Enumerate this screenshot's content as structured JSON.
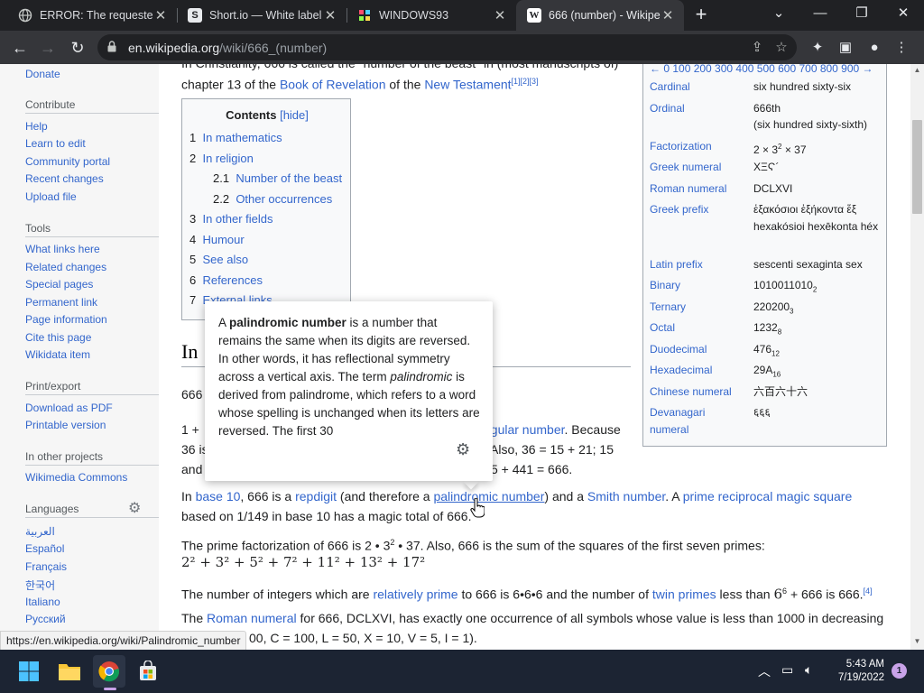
{
  "browser": {
    "tabs": [
      {
        "title": "ERROR: The requested",
        "icon": "globe-icon"
      },
      {
        "title": "Short.io — White label",
        "icon": "shortio-icon"
      },
      {
        "title": "WINDOWS93",
        "icon": "windows93-icon"
      },
      {
        "title": "666 (number) - Wikipe",
        "icon": "wikipedia-icon"
      }
    ],
    "url_domain": "en.wikipedia.org",
    "url_path": "/wiki/666_(number)",
    "status_url": "https://en.wikipedia.org/wiki/Palindromic_number"
  },
  "sidebar": {
    "donate": "Donate",
    "contribute": {
      "heading": "Contribute",
      "items": [
        "Help",
        "Learn to edit",
        "Community portal",
        "Recent changes",
        "Upload file"
      ]
    },
    "tools": {
      "heading": "Tools",
      "items": [
        "What links here",
        "Related changes",
        "Special pages",
        "Permanent link",
        "Page information",
        "Cite this page",
        "Wikidata item"
      ]
    },
    "print": {
      "heading": "Print/export",
      "items": [
        "Download as PDF",
        "Printable version"
      ]
    },
    "projects": {
      "heading": "In other projects",
      "items": [
        "Wikimedia Commons"
      ]
    },
    "languages": {
      "heading": "Languages",
      "items": [
        "العربية",
        "Español",
        "Français",
        "한국어",
        "Italiano",
        "Русский"
      ]
    }
  },
  "article": {
    "top_line_partial": "In Christianity, 666 is called the \"number of the beast\" in (most manuscripts of)",
    "line2_a": "chapter 13 of the ",
    "line2_link1": "Book of Revelation",
    "line2_b": " of the ",
    "line2_link2": "New Testament",
    "line2_sup": "[1][2][3]",
    "toc": {
      "title": "Contents",
      "hide": "[hide]",
      "items": [
        {
          "num": "1",
          "label": "In mathematics"
        },
        {
          "num": "2",
          "label": "In religion"
        },
        {
          "num": "2.1",
          "label": "Number of the beast"
        },
        {
          "num": "2.2",
          "label": "Other occurrences"
        },
        {
          "num": "3",
          "label": "In other fields"
        },
        {
          "num": "4",
          "label": "Humour"
        },
        {
          "num": "5",
          "label": "See also"
        },
        {
          "num": "6",
          "label": "References"
        },
        {
          "num": "7",
          "label": "External links"
        }
      ]
    },
    "heading_partial": "In",
    "p1_partial": "666",
    "p2_l1_start": "1 +",
    "p2_l1_link": "ngular number",
    "p2_l1_end": ". Because",
    "p2_l2_start": "36 is",
    "p2_l2_end": "Also, 36 = 15 + 21; 15",
    "p2_l3_start": "and",
    "p2_l3_end": "5 + 441 = 666.",
    "p3_l1_a": "In ",
    "p3_l1_link1": "base 10",
    "p3_l1_b": ", 666 is a ",
    "p3_l1_link2": "repdigit",
    "p3_l1_c": " (and therefore a ",
    "p3_l1_link3": "palindromic number",
    "p3_l1_d": ") and a ",
    "p3_l1_link4": "Smith number",
    "p3_l1_e": ". A ",
    "p3_l1_link5": "prime reciprocal magic square",
    "p3_l2": "based on 1/149 in base 10 has a magic total of 666.",
    "p4_text": "The prime factorization of 666 is 2 • 3",
    "p4_sup": "2",
    "p4_end": " • 37. Also, 666 is the sum of the squares of the first seven primes:",
    "formula": "2² + 3² + 5² + 7² + 11² + 13² + 17²",
    "p5_a": "The number of integers which are ",
    "p5_link1": "relatively prime",
    "p5_b": " to 666 is 6•6•6 and the number of ",
    "p5_link2": "twin primes",
    "p5_c": " less than ",
    "p5_math": "6",
    "p5_math_sup": "6",
    "p5_d": " + 666 is 666.",
    "p5_sup": "[4]",
    "p6_a": "The ",
    "p6_link": "Roman numeral",
    "p6_b": " for 666, DCLXVI, has exactly one occurrence of all symbols whose value is less than 1000 in decreasing",
    "p6_l2_partial": "00, C = 100, L = 50, X = 10, V = 5, I = 1)."
  },
  "infobox": {
    "nav": "← 0 100 200 300 400 500 600 700 800 900 →",
    "rows": [
      {
        "label": "Cardinal",
        "value": "six hundred sixty-six"
      },
      {
        "label": "Ordinal",
        "value": "666th",
        "value2": "(six hundred sixty-sixth)"
      },
      {
        "label": "Factorization",
        "value": "2 × 3",
        "sup": "2",
        "value_end": " × 37"
      },
      {
        "label": "Greek numeral",
        "value": "ΧΞϚ´"
      },
      {
        "label": "Roman numeral",
        "value": "DCLXVI"
      },
      {
        "label": "Greek prefix",
        "value": "ἑξακόσιοι ἑξήκοντα ἕξ hexakósioi hexēkonta héx"
      },
      {
        "label": "Latin prefix",
        "value": "sescenti sexaginta sex"
      },
      {
        "label": "Binary",
        "value": "1010011010",
        "sub": "2"
      },
      {
        "label": "Ternary",
        "value": "220200",
        "sub": "3"
      },
      {
        "label": "Octal",
        "value": "1232",
        "sub": "8"
      },
      {
        "label": "Duodecimal",
        "value": "476",
        "sub": "12"
      },
      {
        "label": "Hexadecimal",
        "value": "29A",
        "sub": "16"
      },
      {
        "label": "Chinese numeral",
        "value": "六百六十六"
      },
      {
        "label": "Devanagari numeral",
        "value": "६६६"
      }
    ]
  },
  "popup": {
    "bold": "palindromic number",
    "pre": "A ",
    "text1": " is a number that remains the same when its digits are reversed. In other words, it has reflectional symmetry across a vertical axis. The term ",
    "italic": "palindromic",
    "text2": " is derived from palindrome, which refers to a word whose spelling is unchanged when its letters are reversed. The first 30"
  },
  "taskbar": {
    "time": "5:43 AM",
    "date": "7/19/2022",
    "notifications": "1"
  },
  "colors": {
    "link": "#3366cc",
    "chrome_dark": "#202124",
    "chrome_tab": "#35363a",
    "taskbar": "#1c2433"
  }
}
